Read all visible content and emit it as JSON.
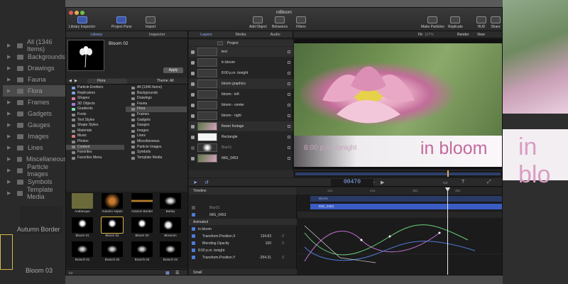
{
  "window": {
    "title": "inBloom"
  },
  "toolbar": {
    "library_inspector": "Library Inspector",
    "project_pane": "Project Pane",
    "import": "Import",
    "add_object": "Add Object",
    "behaviors": "Behaviors",
    "filters": "Filters",
    "make_particles": "Make Particles",
    "replicate": "Replicate",
    "hud": "HUD",
    "share": "Share"
  },
  "library": {
    "tabs": [
      "Library",
      "Inspector"
    ],
    "preview_title": "Bloom 02",
    "apply": "Apply",
    "crumb": "Flora",
    "theme": "Theme: All",
    "categories": [
      "Particle Emitters",
      "Replicators",
      "Shapes",
      "3D Objects",
      "Gradients",
      "Fonts",
      "Text Styles",
      "Shape Styles",
      "Materials",
      "Music",
      "Photos",
      "Content",
      "Favorites",
      "Favorites Menu"
    ],
    "subcategories": [
      "All (1346 Items)",
      "Backgrounds",
      "Drawings",
      "Fauna",
      "Flora",
      "Frames",
      "Gadgets",
      "Gauges",
      "Images",
      "Lines",
      "Miscellaneous",
      "Particle Images",
      "Symbols",
      "Template Media"
    ],
    "grid": [
      "Arabesque",
      "Autumn Aspen",
      "Autumn Border",
      "Barley",
      "Bloom 01",
      "Bloom 02",
      "Bloom 03",
      "Blossom",
      "Branch 01",
      "Branch 02",
      "Branch 03",
      "Branch 04"
    ]
  },
  "layers": {
    "tabs": [
      "Layers",
      "Media",
      "Audio"
    ],
    "rows": [
      "Project",
      "text",
      "in bloom",
      "8:00 p.m. tonight",
      "bloom graphics",
      "bloom - left",
      "bloom - center",
      "bloom - right",
      "flower footage",
      "Rectangle",
      "Blur01",
      "IMG_0453"
    ]
  },
  "canvas": {
    "fit": "Fit:",
    "fit_value": "107%",
    "render": "Render",
    "view": "View",
    "overlay_time": "8:00 p.m. tonight",
    "overlay_title": "in bloom"
  },
  "transport": {
    "timecode": "00470"
  },
  "timeline": {
    "header": "Timeline",
    "layer_rows": [
      "Blur01",
      "IMG_0453"
    ],
    "animated_label": "Animated",
    "params": [
      {
        "label": "in bloom",
        "value": "",
        "value2": ""
      },
      {
        "label": "Transform.Position.X",
        "value": "134.83",
        "value2": "0"
      },
      {
        "label": "Blending.Opacity",
        "value": "100",
        "value2": "0"
      },
      {
        "label": "8:00 p.m. tonight",
        "value": "",
        "value2": ""
      },
      {
        "label": "Transform.Position.Y",
        "value": "-254.31",
        "value2": "0"
      }
    ],
    "clips": [
      "Blur01",
      "IMG_0453"
    ],
    "ruler_marks": [
      "121",
      "241",
      "361",
      "481"
    ],
    "zoom_label": "Small"
  },
  "background": {
    "sidebar": [
      "All (1346 Items)",
      "Backgrounds",
      "Drawings",
      "Fauna",
      "Flora",
      "Frames",
      "Gadgets",
      "Gauges",
      "Images",
      "Lines",
      "Miscellaneous",
      "Particle Images",
      "Symbols",
      "Template Media"
    ],
    "thumbs": [
      "Autumn Border",
      "Bloom 03"
    ],
    "overlay_title": "in blo"
  },
  "colors": {
    "accent": "#4f7ad8",
    "title_pink": "#c46aa0",
    "timecode": "#8fb0ff"
  }
}
